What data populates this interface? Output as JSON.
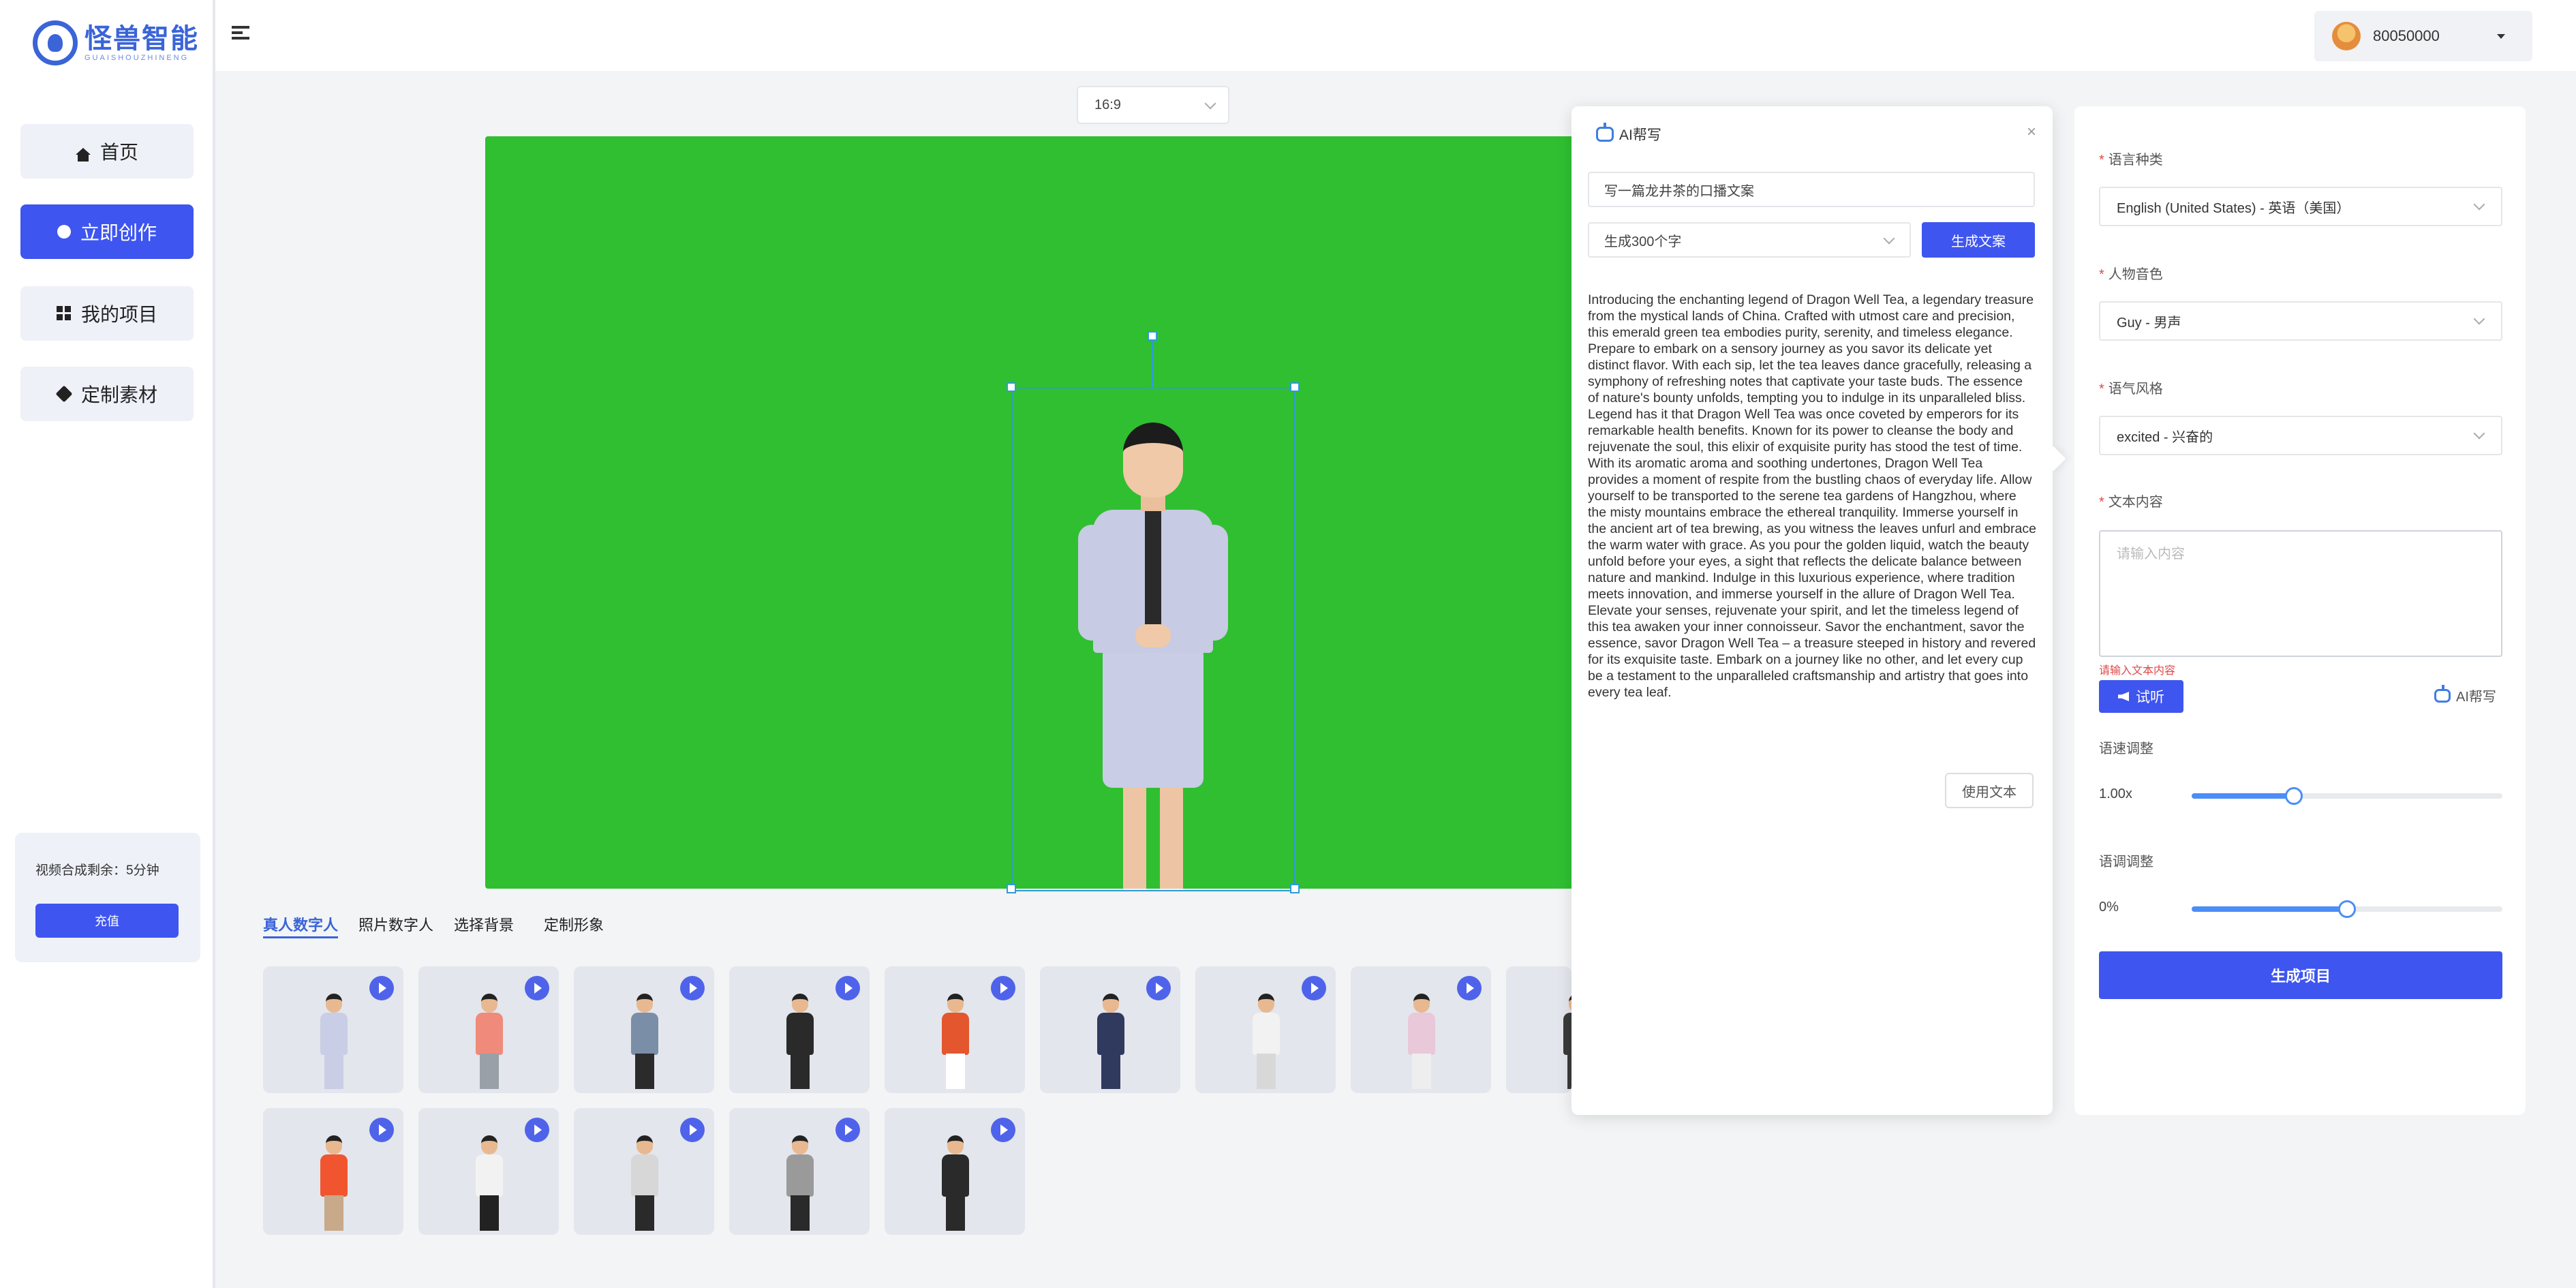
{
  "brand": {
    "name_cn": "怪兽智能",
    "name_en": "GUAISHOUZHINENG"
  },
  "sidebar": {
    "items": [
      {
        "label": "首页",
        "icon": "home-icon"
      },
      {
        "label": "立即创作",
        "icon": "create-icon",
        "active": true
      },
      {
        "label": "我的项目",
        "icon": "projects-icon"
      },
      {
        "label": "定制素材",
        "icon": "material-icon"
      }
    ],
    "quota_text": "视频合成剩余：5分钟",
    "recharge_label": "充值"
  },
  "header": {
    "user_id": "80050000"
  },
  "canvas": {
    "ratio": "16:9",
    "background_color": "#2fbf31"
  },
  "tabs": [
    {
      "label": "真人数字人",
      "active": true
    },
    {
      "label": "照片数字人"
    },
    {
      "label": "选择背景"
    },
    {
      "label": "定制形象"
    }
  ],
  "avatars": [
    {
      "top": "#c9cde5",
      "bottom": "#c9cde5"
    },
    {
      "top": "#f08a7a",
      "bottom": "#9aa0a8"
    },
    {
      "top": "#7a8ea8",
      "bottom": "#2b2b2b"
    },
    {
      "top": "#2a2a2a",
      "bottom": "#2a2a2a"
    },
    {
      "top": "#e4572e",
      "bottom": "#ffffff"
    },
    {
      "top": "#2f3a5e",
      "bottom": "#2f3a5e"
    },
    {
      "top": "#f2f2f2",
      "bottom": "#d8d8d8"
    },
    {
      "top": "#e9c8d9",
      "bottom": "#eeeeee"
    },
    {
      "top": "#3a3a3a",
      "bottom": "#3a3a3a"
    },
    {
      "top": "#f0552f",
      "bottom": "#c8a98a"
    },
    {
      "top": "#f2f2f2",
      "bottom": "#222222"
    },
    {
      "top": "#d7d7d7",
      "bottom": "#2a2a2a"
    },
    {
      "top": "#9a9a9a",
      "bottom": "#2a2a2a"
    },
    {
      "top": "#2a2a2a",
      "bottom": "#2a2a2a"
    }
  ],
  "ai_helper": {
    "title": "AI帮写",
    "prompt": "写一篇龙井茶的口播文案",
    "length_option": "生成300个字",
    "generate_label": "生成文案",
    "output": "Introducing the enchanting legend of Dragon Well Tea, a legendary treasure from the mystical lands of China. Crafted with utmost care and precision, this emerald green tea embodies purity, serenity, and timeless elegance. Prepare to embark on a sensory journey as you savor its delicate yet distinct flavor. With each sip, let the tea leaves dance gracefully, releasing a symphony of refreshing notes that captivate your taste buds. The essence of nature's bounty unfolds, tempting you to indulge in its unparalleled bliss. Legend has it that Dragon Well Tea was once coveted by emperors for its remarkable health benefits. Known for its power to cleanse the body and rejuvenate the soul, this elixir of exquisite purity has stood the test of time. With its aromatic aroma and soothing undertones, Dragon Well Tea provides a moment of respite from the bustling chaos of everyday life. Allow yourself to be transported to the serene tea gardens of Hangzhou, where the misty mountains embrace the ethereal tranquility. Immerse yourself in the ancient art of tea brewing, as you witness the leaves unfurl and embrace the warm water with grace. As you pour the golden liquid, watch the beauty unfold before your eyes, a sight that reflects the delicate balance between nature and mankind. Indulge in this luxurious experience, where tradition meets innovation, and immerse yourself in the allure of Dragon Well Tea. Elevate your senses, rejuvenate your spirit, and let the timeless legend of this tea awaken your inner connoisseur. Savor the enchantment, savor the essence, savor Dragon Well Tea – a treasure steeped in history and revered for its exquisite taste. Embark on a journey like no other, and let every cup be a testament to the unparalleled craftsmanship and artistry that goes into every tea leaf.",
    "use_text_label": "使用文本"
  },
  "form": {
    "language_label": "语言种类",
    "language_value": "English (United States) - 英语（美国）",
    "voice_label": "人物音色",
    "voice_value": "Guy - 男声",
    "style_label": "语气风格",
    "style_value": "excited - 兴奋的",
    "text_label": "文本内容",
    "text_placeholder": "请输入内容",
    "text_error": "请输入文本内容",
    "listen_label": "试听",
    "ai_link_label": "AI帮写",
    "speed_label": "语速调整",
    "speed_value": "1.00x",
    "speed_fraction": 0.33,
    "pitch_label": "语调调整",
    "pitch_value": "0%",
    "pitch_fraction": 0.5,
    "submit_label": "生成项目"
  },
  "colors": {
    "primary": "#3e55ef",
    "slider": "#4c8df6",
    "error": "#e04848"
  }
}
